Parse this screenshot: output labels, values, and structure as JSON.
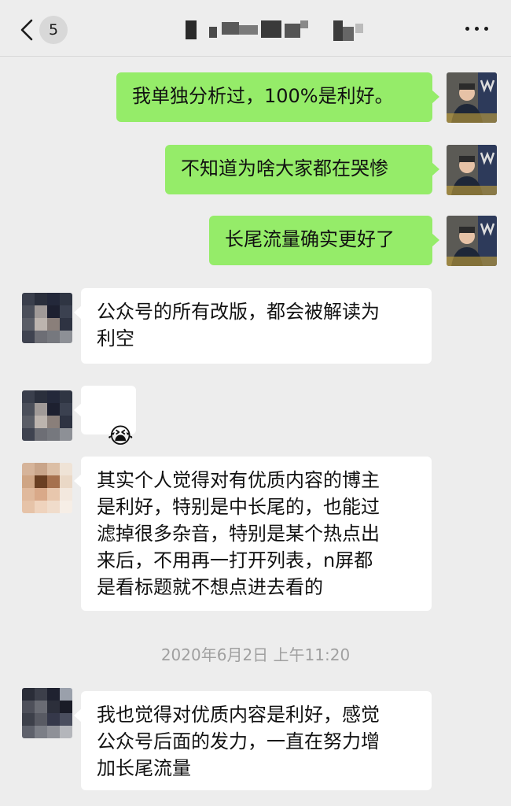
{
  "header": {
    "unread_count": "5",
    "back_icon": "chevron-left-icon",
    "more_icon": "more-dots-icon"
  },
  "messages": [
    {
      "side": "out",
      "text": "我单独分析过，100%是利好。"
    },
    {
      "side": "out",
      "text": "不知道为啥大家都在哭惨"
    },
    {
      "side": "out",
      "text": "长尾流量确实更好了"
    },
    {
      "side": "in",
      "text": "公众号的所有改版，都会被解读为\n利空"
    },
    {
      "side": "in",
      "text": "😭",
      "is_emoji": true
    },
    {
      "side": "in",
      "text": "其实个人觉得对有优质内容的博主\n是利好，特别是中长尾的，也能过\n滤掉很多杂音，特别是某个热点出\n来后，不用再一打开列表，n屏都\n是看标题就不想点进去看的"
    },
    {
      "side": "in",
      "text": "我也觉得对优质内容是利好，感觉\n公众号后面的发力，一直在努力增\n加长尾流量"
    }
  ],
  "timestamp": "2020年6月2日 上午11:20",
  "colors": {
    "background": "#ededed",
    "outgoing_bubble": "#95ec69",
    "incoming_bubble": "#ffffff",
    "timestamp_text": "#a0a0a0"
  }
}
